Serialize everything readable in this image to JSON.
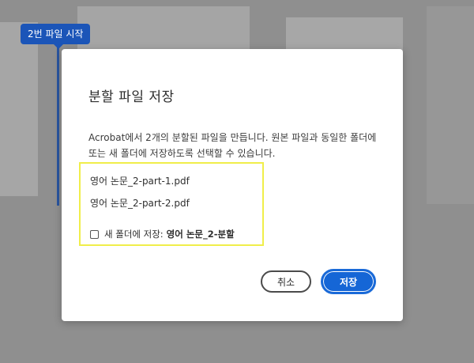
{
  "background": {
    "start_tag": "2번 파일 시작"
  },
  "dialog": {
    "title": "분할 파일 저장",
    "description": "Acrobat에서 2개의 분할된 파일을 만듭니다. 원본 파일과 동일한 폴더에 또는 새 폴더에 저장하도록 선택할 수 있습니다.",
    "files": [
      "영어 논문_2-part-1.pdf",
      "영어 논문_2-part-2.pdf"
    ],
    "checkbox": {
      "label": "새 폴더에 저장:",
      "folder_name": "영어 논문_2-분할",
      "checked": false
    },
    "buttons": {
      "cancel": "취소",
      "save": "저장"
    }
  },
  "colors": {
    "accent": "#1566d6",
    "highlight": "#f0ee4a",
    "overlay": "#8f8f8f"
  }
}
